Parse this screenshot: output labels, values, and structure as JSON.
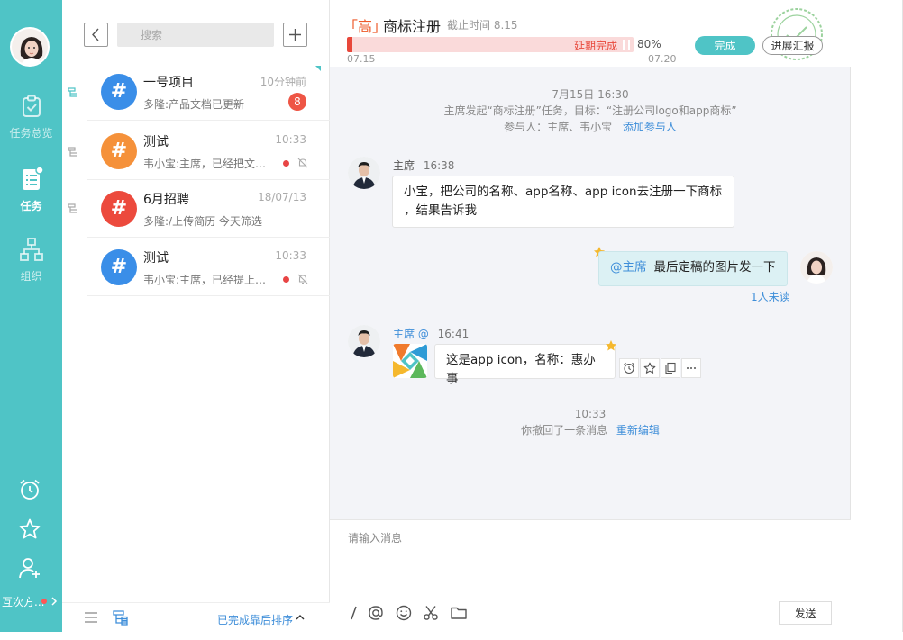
{
  "rail": {
    "items": [
      {
        "label": "任务总览",
        "icon": "clipboard-check-icon"
      },
      {
        "label": "任务",
        "icon": "task-list-icon"
      },
      {
        "label": "组织",
        "icon": "org-chart-icon"
      }
    ],
    "bottom_label": "互次方...",
    "bottom_icons": [
      "alarm-clock-icon",
      "star-icon",
      "add-user-icon"
    ]
  },
  "list": {
    "search_placeholder": "搜索",
    "conversations": [
      {
        "title": "一号项目",
        "time": "10分钟前",
        "preview": "多隆:产品文档已更新",
        "badge": "8",
        "color": "#3a8ee8"
      },
      {
        "title": "测试",
        "time": "10:33",
        "preview": "韦小宝:主席，已经把文件放到文件夹",
        "color": "#f5913a"
      },
      {
        "title": "6月招聘",
        "time": "18/07/13",
        "preview": "多隆:/上传简历 今天筛选",
        "color": "#ec4a3d"
      },
      {
        "title": "测试",
        "time": "10:33",
        "preview": "韦小宝:主席，已经提上日程了",
        "color": "#3a8ee8"
      }
    ],
    "footer_sort": "已完成靠后排序"
  },
  "task": {
    "priority": "「高」",
    "title": "商标注册",
    "deadline": "截止时间 8.15",
    "status_text": "延期完成",
    "progress_percent": 80,
    "progress_label": "80%",
    "start": "07.15",
    "end": "07.20",
    "done_btn": "完成",
    "report_btn": "进展汇报"
  },
  "chat": {
    "sys1": {
      "time": "7月15日 16:30",
      "line": "主席发起“商标注册”任务，目标：“注册公司logo和app商标”",
      "members": "参与人：主席、韦小宝",
      "add_link": "添加参与人"
    },
    "msg1": {
      "sender": "主席",
      "time": "16:38",
      "line1": "小宝，把公司的名称、app名称、app icon去注册一下商标",
      "line2": "，结果告诉我"
    },
    "msg2": {
      "at": "@主席",
      "text": "最后定稿的图片发一下",
      "unread": "1人未读"
    },
    "msg3": {
      "sender": "主席 @",
      "time": "16:41",
      "text": "这是app icon，名称：惠办事"
    },
    "sys2": {
      "time": "10:33",
      "line": "你撤回了一条消息",
      "link": "重新编辑"
    }
  },
  "composer": {
    "placeholder": "请输入消息",
    "send": "发送"
  }
}
